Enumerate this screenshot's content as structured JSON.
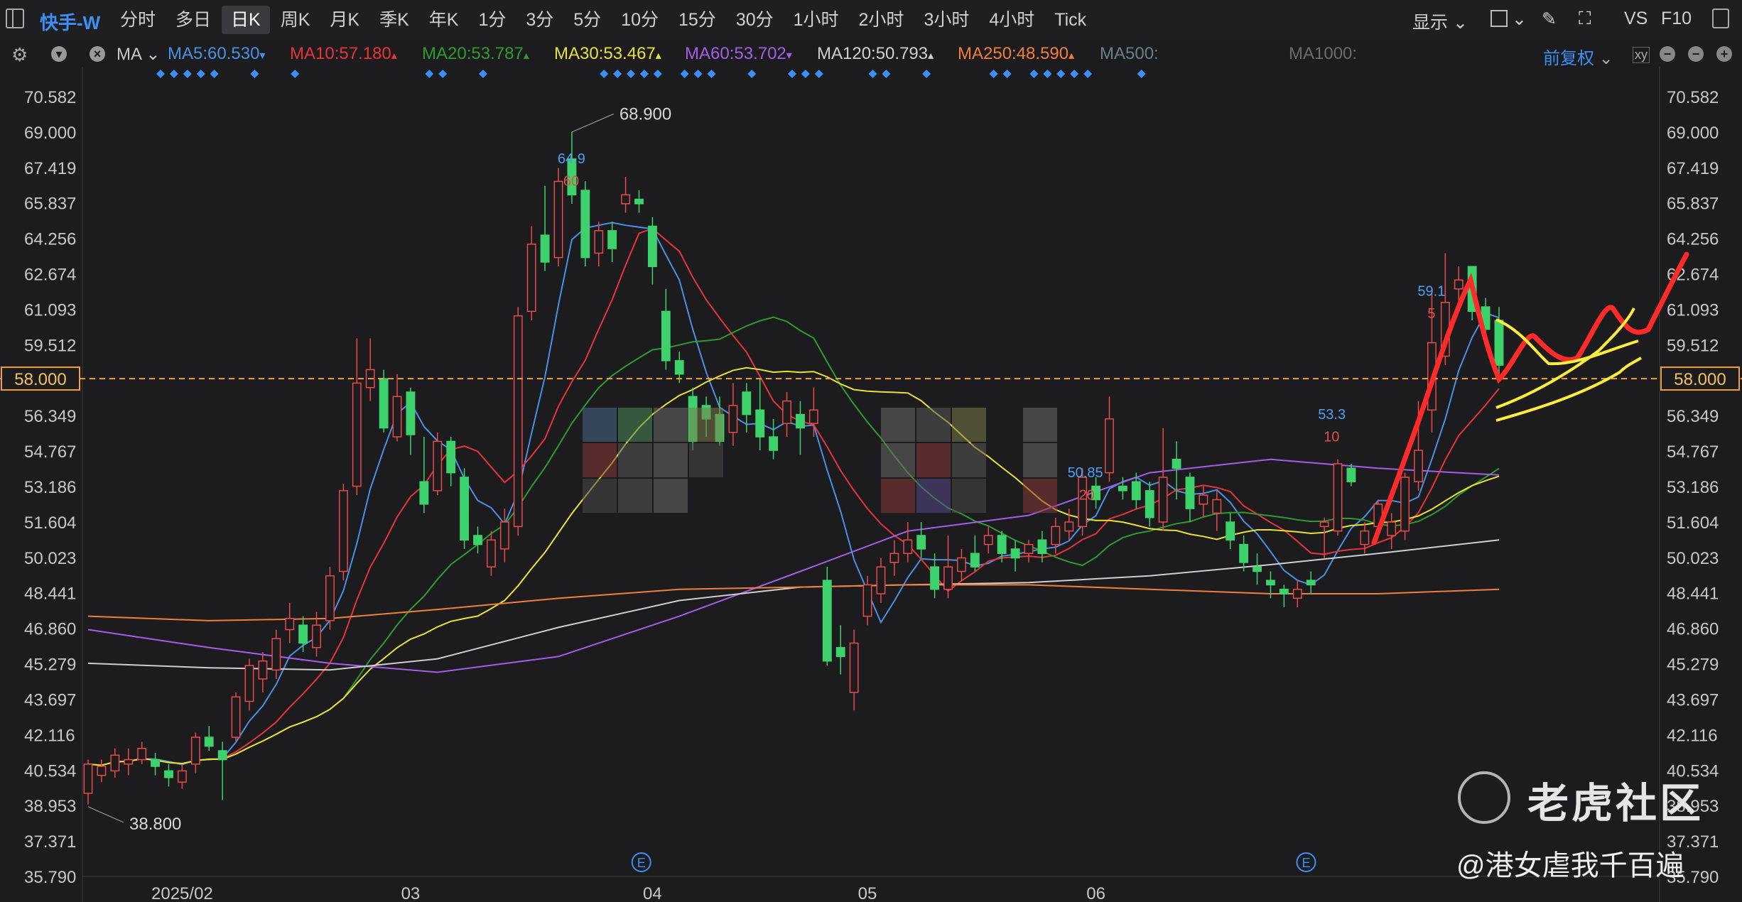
{
  "header": {
    "stock_name": "快手-W",
    "periods": [
      "分时",
      "多日",
      "日K",
      "周K",
      "月K",
      "季K",
      "年K",
      "1分",
      "3分",
      "5分",
      "10分",
      "15分",
      "30分",
      "1小时",
      "2小时",
      "3小时",
      "4小时",
      "Tick"
    ],
    "active_period": "日K",
    "display_label": "显示",
    "vs_label": "VS",
    "f10_label": "F10"
  },
  "ma_bar": {
    "ma_label": "MA",
    "items": [
      {
        "text": "MA5:60.530",
        "color": "#4a90e2",
        "arrow": "▾"
      },
      {
        "text": "MA10:57.180",
        "color": "#e8333a",
        "arrow": "▴"
      },
      {
        "text": "MA20:53.787",
        "color": "#2e9b2e",
        "arrow": "▴"
      },
      {
        "text": "MA30:53.467",
        "color": "#e8e03a",
        "arrow": "▴"
      },
      {
        "text": "MA60:53.702",
        "color": "#a25ee8",
        "arrow": "▾"
      },
      {
        "text": "MA120:50.793",
        "color": "#cfcfcf",
        "arrow": "▴"
      },
      {
        "text": "MA250:48.590",
        "color": "#f07e3a",
        "arrow": "▴"
      },
      {
        "text": "MA500:",
        "color": "#6b7f8a",
        "arrow": ""
      },
      {
        "text": "MA1000:",
        "color": "#6b6b6b",
        "arrow": ""
      }
    ],
    "adjust_label": "前复权"
  },
  "chart_data": {
    "type": "candlestick",
    "y_ticks": [
      "70.582",
      "69.000",
      "67.419",
      "65.837",
      "64.256",
      "62.674",
      "61.093",
      "59.512",
      "58.000",
      "56.349",
      "54.767",
      "53.186",
      "51.604",
      "50.023",
      "48.441",
      "46.860",
      "45.279",
      "43.697",
      "42.116",
      "40.534",
      "38.953",
      "37.371",
      "35.790"
    ],
    "ylim": [
      35.79,
      70.582
    ],
    "x_labels": [
      {
        "label": "2025/02",
        "index": 7
      },
      {
        "label": "03",
        "index": 24
      },
      {
        "label": "04",
        "index": 42
      },
      {
        "label": "05",
        "index": 58
      },
      {
        "label": "06",
        "index": 75
      }
    ],
    "current_price": "58.000",
    "annotations": {
      "high": "68.900",
      "low": "38.800",
      "ma5_high": "64.9",
      "ma10_high": "60",
      "mid_a": "50.85",
      "mid_b": "20",
      "mid_c": "53.3",
      "mid_d": "10",
      "recent_a": "59.1",
      "recent_b": "5"
    },
    "event_marker": "E",
    "candles": [
      [
        39.5,
        40.8,
        39.0,
        41.0
      ],
      [
        40.3,
        40.7,
        40.0,
        41.0
      ],
      [
        40.5,
        41.2,
        40.2,
        41.5
      ],
      [
        40.8,
        41.0,
        40.3,
        41.5
      ],
      [
        41.0,
        41.5,
        40.8,
        41.8
      ],
      [
        41.0,
        40.7,
        40.3,
        41.3
      ],
      [
        40.5,
        40.2,
        39.8,
        40.8
      ],
      [
        40.0,
        40.5,
        39.7,
        40.8
      ],
      [
        40.8,
        42.0,
        40.4,
        42.2
      ],
      [
        42.0,
        41.6,
        41.4,
        42.5
      ],
      [
        41.4,
        41.0,
        39.2,
        41.8
      ],
      [
        42.0,
        43.8,
        41.8,
        44.0
      ],
      [
        43.6,
        45.2,
        43.2,
        45.5
      ],
      [
        44.6,
        45.4,
        44.0,
        45.8
      ],
      [
        45.0,
        46.4,
        44.6,
        46.8
      ],
      [
        46.8,
        47.3,
        46.2,
        48.0
      ],
      [
        47.0,
        46.2,
        45.8,
        47.4
      ],
      [
        46.0,
        47.0,
        45.6,
        47.6
      ],
      [
        47.2,
        49.2,
        46.8,
        49.6
      ],
      [
        49.4,
        53.0,
        49.0,
        53.3
      ],
      [
        53.2,
        57.8,
        52.8,
        59.8
      ],
      [
        57.6,
        58.4,
        57.0,
        59.8
      ],
      [
        58.0,
        55.8,
        55.6,
        58.4
      ],
      [
        55.4,
        57.2,
        55.2,
        58.2
      ],
      [
        57.4,
        55.5,
        54.6,
        57.6
      ],
      [
        53.4,
        52.4,
        52.0,
        55.4
      ],
      [
        53.0,
        55.2,
        52.8,
        55.6
      ],
      [
        55.2,
        53.8,
        53.2,
        55.4
      ],
      [
        53.6,
        50.8,
        50.4,
        54.0
      ],
      [
        51.0,
        50.6,
        50.2,
        51.4
      ],
      [
        49.6,
        50.8,
        49.2,
        51.2
      ],
      [
        50.4,
        51.6,
        49.8,
        52.2
      ],
      [
        51.4,
        60.8,
        51.0,
        61.2
      ],
      [
        61.0,
        64.0,
        60.6,
        64.8
      ],
      [
        64.4,
        63.2,
        62.8,
        66.6
      ],
      [
        63.4,
        66.8,
        63.0,
        67.4
      ],
      [
        67.8,
        66.2,
        65.8,
        69.0
      ],
      [
        66.4,
        63.4,
        63.0,
        66.8
      ],
      [
        63.6,
        64.6,
        63.0,
        65.0
      ],
      [
        64.6,
        63.8,
        63.2,
        65.0
      ],
      [
        65.8,
        66.2,
        65.4,
        67.0
      ],
      [
        66.0,
        65.8,
        65.4,
        66.4
      ],
      [
        64.8,
        63.0,
        62.2,
        65.2
      ],
      [
        61.0,
        58.8,
        58.4,
        62.0
      ],
      [
        58.8,
        58.2,
        57.8,
        59.2
      ],
      [
        57.2,
        55.2,
        54.8,
        57.6
      ],
      [
        56.8,
        56.2,
        55.4,
        57.2
      ],
      [
        56.4,
        55.2,
        55.0,
        57.2
      ],
      [
        55.6,
        56.8,
        55.0,
        57.8
      ],
      [
        57.4,
        56.4,
        55.6,
        57.8
      ],
      [
        56.6,
        55.4,
        54.8,
        58.0
      ],
      [
        55.4,
        54.8,
        54.4,
        56.2
      ],
      [
        56.0,
        57.0,
        55.4,
        57.4
      ],
      [
        56.4,
        55.8,
        54.6,
        57.0
      ],
      [
        56.0,
        56.6,
        55.4,
        57.6
      ],
      [
        49.0,
        45.4,
        45.2,
        49.6
      ],
      [
        46.0,
        45.6,
        44.8,
        47.0
      ],
      [
        44.0,
        46.2,
        43.2,
        46.8
      ],
      [
        47.4,
        48.8,
        47.0,
        49.2
      ],
      [
        48.4,
        49.6,
        48.0,
        50.0
      ],
      [
        49.8,
        50.2,
        49.2,
        50.8
      ],
      [
        50.2,
        50.8,
        49.8,
        51.6
      ],
      [
        51.0,
        50.4,
        50.0,
        51.6
      ],
      [
        49.6,
        48.6,
        48.2,
        50.2
      ],
      [
        48.6,
        49.6,
        48.2,
        51.0
      ],
      [
        49.4,
        50.0,
        49.0,
        50.4
      ],
      [
        50.2,
        49.6,
        49.4,
        51.0
      ],
      [
        50.6,
        51.0,
        50.2,
        51.4
      ],
      [
        51.0,
        50.2,
        49.8,
        51.2
      ],
      [
        50.4,
        50.0,
        49.4,
        50.8
      ],
      [
        50.2,
        50.6,
        49.8,
        50.8
      ],
      [
        50.8,
        50.2,
        49.8,
        51.2
      ],
      [
        50.6,
        51.4,
        50.2,
        51.8
      ],
      [
        51.2,
        51.6,
        50.8,
        52.2
      ],
      [
        51.4,
        53.6,
        51.0,
        54.0
      ],
      [
        53.2,
        52.6,
        52.2,
        53.6
      ],
      [
        53.8,
        56.2,
        53.4,
        57.2
      ],
      [
        53.2,
        53.0,
        52.6,
        53.6
      ],
      [
        53.4,
        52.6,
        52.2,
        53.8
      ],
      [
        53.0,
        51.8,
        51.4,
        53.4
      ],
      [
        51.6,
        53.6,
        51.2,
        55.8
      ],
      [
        54.4,
        54.0,
        52.6,
        55.2
      ],
      [
        53.6,
        52.2,
        51.6,
        53.8
      ],
      [
        52.4,
        52.8,
        51.8,
        53.2
      ],
      [
        52.0,
        52.6,
        51.2,
        53.0
      ],
      [
        51.6,
        50.8,
        50.4,
        52.0
      ],
      [
        50.6,
        49.8,
        49.4,
        51.0
      ],
      [
        49.6,
        49.4,
        48.8,
        50.2
      ],
      [
        49.0,
        48.8,
        48.2,
        49.4
      ],
      [
        48.6,
        48.4,
        47.8,
        48.8
      ],
      [
        48.2,
        48.6,
        47.8,
        49.0
      ],
      [
        49.0,
        48.8,
        48.4,
        49.4
      ],
      [
        51.4,
        51.6,
        50.0,
        51.8
      ],
      [
        51.2,
        54.2,
        51.0,
        54.4
      ],
      [
        54.0,
        53.4,
        53.2,
        54.2
      ],
      [
        50.6,
        51.2,
        50.2,
        51.6
      ],
      [
        51.4,
        52.4,
        51.2,
        52.6
      ],
      [
        51.0,
        51.6,
        50.4,
        52.0
      ],
      [
        51.2,
        53.6,
        50.8,
        53.8
      ],
      [
        53.4,
        54.8,
        53.0,
        57.0
      ],
      [
        56.6,
        59.6,
        55.6,
        62.0
      ],
      [
        59.0,
        61.4,
        58.6,
        63.6
      ],
      [
        62.0,
        62.4,
        61.2,
        63.0
      ],
      [
        63.0,
        61.0,
        60.6,
        63.0
      ],
      [
        61.2,
        60.2,
        59.6,
        61.6
      ],
      [
        60.6,
        58.6,
        58.2,
        61.2
      ]
    ]
  }
}
